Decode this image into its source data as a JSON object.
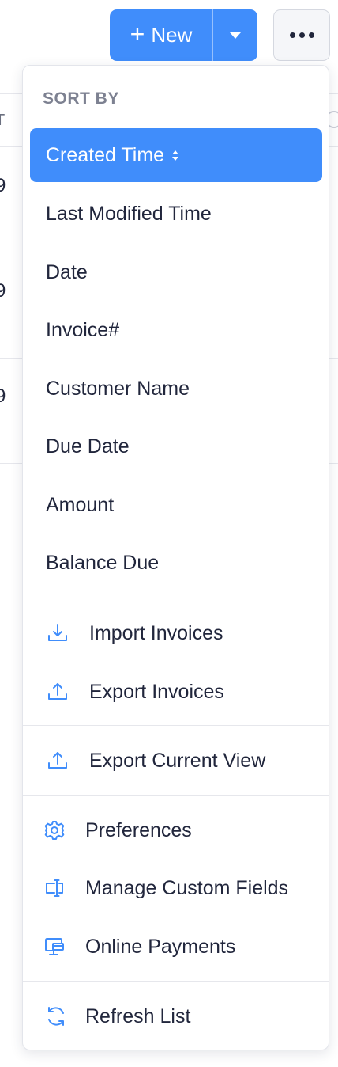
{
  "toolbar": {
    "new_label": "New",
    "new_icon": "plus-icon",
    "dropdown_icon": "caret-down-icon",
    "more_icon": "more-horizontal-icon"
  },
  "background": {
    "header_cut_text": "T",
    "row_cut_texts": [
      "9",
      "9",
      "9"
    ]
  },
  "menu": {
    "sort_title": "SORT BY",
    "sort_items": [
      {
        "label": "Created Time",
        "active": true
      },
      {
        "label": "Last Modified Time"
      },
      {
        "label": "Date"
      },
      {
        "label": "Invoice#"
      },
      {
        "label": "Customer Name"
      },
      {
        "label": "Due Date"
      },
      {
        "label": "Amount"
      },
      {
        "label": "Balance Due"
      }
    ],
    "actions": [
      {
        "label": "Import Invoices",
        "icon": "import-icon"
      },
      {
        "label": "Export Invoices",
        "icon": "export-icon"
      },
      {
        "label": "Export Current View",
        "icon": "export-icon"
      },
      {
        "label": "Preferences",
        "icon": "gear-icon"
      },
      {
        "label": "Manage Custom Fields",
        "icon": "custom-field-icon"
      },
      {
        "label": "Online Payments",
        "icon": "online-payment-icon"
      },
      {
        "label": "Refresh List",
        "icon": "refresh-icon"
      }
    ]
  },
  "colors": {
    "accent": "#408dfb",
    "icon": "#408dfb",
    "text": "#21263c",
    "muted": "#7d8191"
  }
}
